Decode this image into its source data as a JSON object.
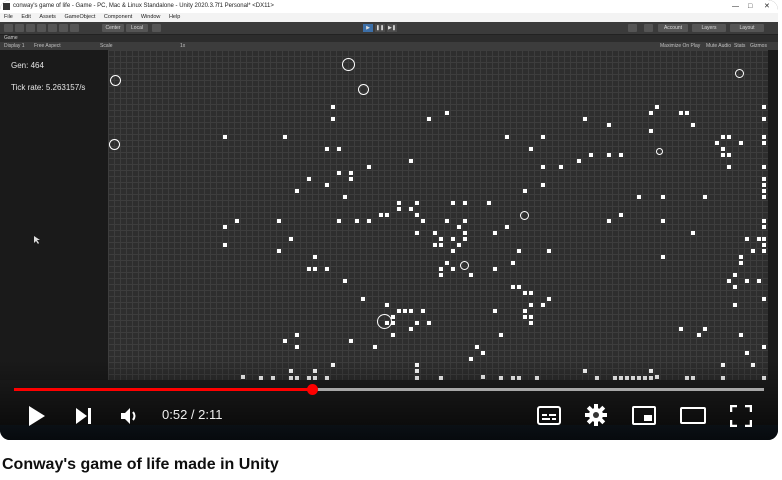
{
  "editor": {
    "window_title": "conway's game of life - Game - PC, Mac & Linux Standalone - Unity 2020.3.7f1 Personal* <DX11>",
    "window_controls": [
      "—",
      "□",
      "✕"
    ],
    "menu": [
      "File",
      "Edit",
      "Assets",
      "GameObject",
      "Component",
      "Window",
      "Help"
    ],
    "toolbar": {
      "center_label": "Center",
      "local_label": "Local",
      "account": "Account",
      "layers": "Layers",
      "layout": "Layout"
    },
    "tab_label": "Game",
    "game_bar": {
      "display": "Display 1",
      "aspect": "Free Aspect",
      "scale_label": "Scale",
      "scale_value": "1x",
      "maximize": "Maximize On Play",
      "mute": "Mute Audio",
      "stats": "Stats",
      "gizmos": "Gizmos"
    }
  },
  "game": {
    "generation_text": "Gen: 464",
    "tick_rate_text": "Tick rate: 5.263157/s"
  },
  "player": {
    "current_time": "0:52",
    "duration": "2:11",
    "time_display": "0:52 / 2:11",
    "progress_fraction": 0.397,
    "accent_color": "#ff0000",
    "controls": [
      "play-icon",
      "next-icon",
      "volume-icon",
      "subtitles-icon",
      "settings-icon",
      "miniplayer-icon",
      "theater-icon",
      "fullscreen-icon"
    ]
  },
  "video": {
    "title": "Conway's game of life made in Unity"
  }
}
